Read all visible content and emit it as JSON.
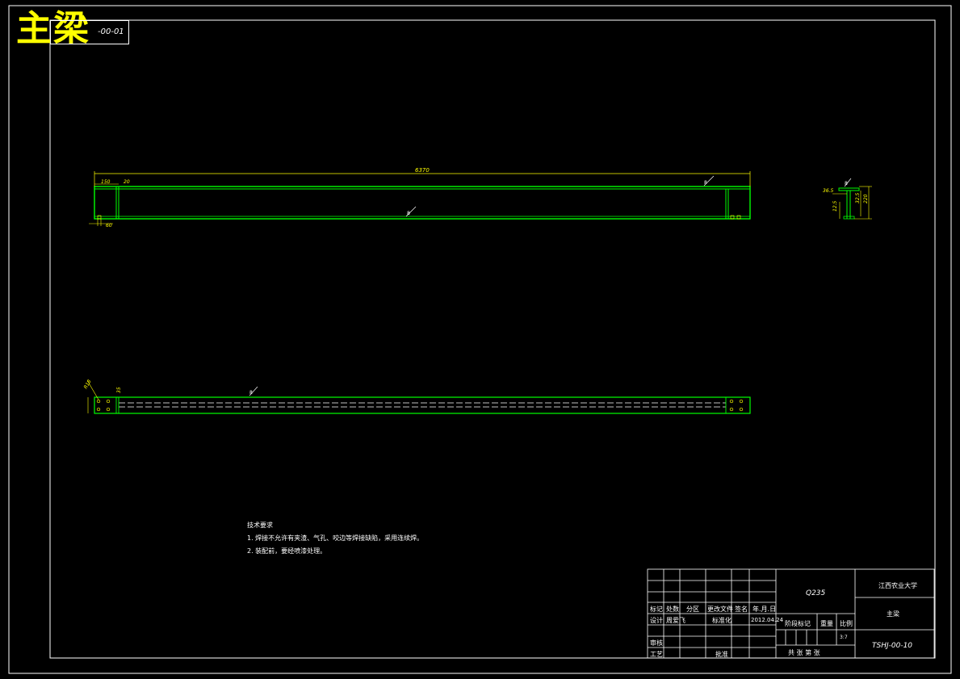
{
  "drawing": {
    "big_title": "主梁",
    "drawing_code_box": "-00-01",
    "dimensions": {
      "overall_length": "6370",
      "left_offset": "150",
      "web_thickness": "20",
      "bottom_small": "60",
      "side_w": "36.5",
      "side_h1": "32.5",
      "side_h2": "220",
      "side_h3": "12.5",
      "plan_dim1": "R18",
      "plan_dim2": "35"
    },
    "weld_symbols": [
      "8",
      "8",
      "8",
      "8",
      "8"
    ],
    "technical_requirements": {
      "heading": "技术要求",
      "items": [
        "1. 焊接不允许有夹渣、气孔、咬边等焊接缺陷，采用连续焊。",
        "2. 装配前，要经喷漆处理。"
      ]
    },
    "title_block": {
      "material": "Q235",
      "school": "江西农业大学",
      "part_name": "主梁",
      "drawing_number": "TSHJ-00-10",
      "scale_value": "3:7",
      "row_labels": {
        "mark": "标记",
        "count": "处数",
        "zone": "分区",
        "change_doc": "更改文件",
        "signature": "签名",
        "date_ymd": "年.月.日",
        "design": "设计",
        "designer": "周爱飞",
        "standardization": "标准化",
        "date_value": "2012.04.24",
        "review": "审核",
        "process": "工艺",
        "approve": "批准",
        "stage_mark": "阶段标记",
        "weight": "重量",
        "scale": "比例",
        "sheets": "共    张   第    张"
      }
    },
    "colors": {
      "background": "#000000",
      "frame": "#ffffff",
      "outline": "#00ff00",
      "dimension": "#ffff00",
      "text": "#ffffff",
      "title": "#ffff00"
    }
  }
}
